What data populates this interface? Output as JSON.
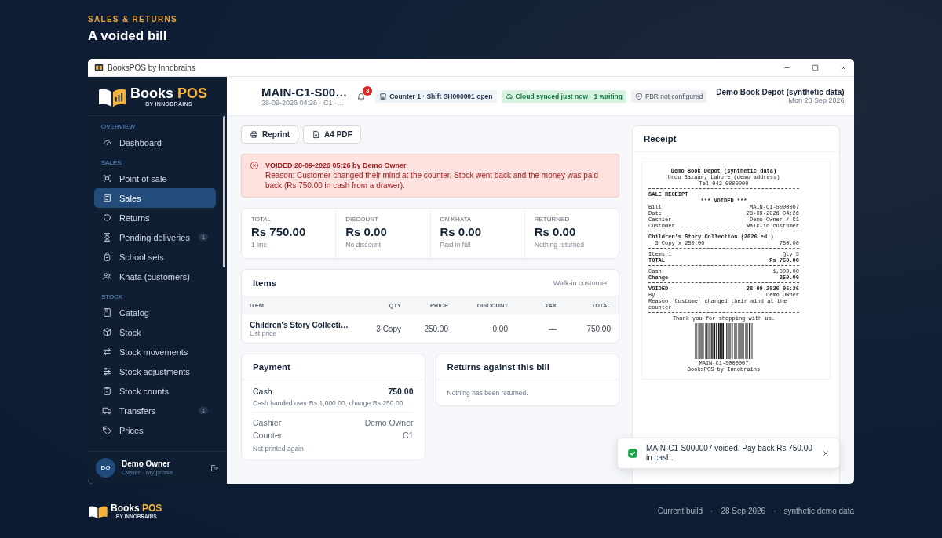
{
  "page": {
    "eyebrow": "SALES & RETURNS",
    "title": "A voided bill"
  },
  "window": {
    "title": "BooksPOS by Innobrains"
  },
  "brand": {
    "name": "Books",
    "accent": "POS",
    "tagline": "BY INNOBRAINS"
  },
  "sidebar": {
    "sections": [
      {
        "label": "OVERVIEW",
        "items": [
          {
            "label": "Dashboard",
            "selected": false
          }
        ]
      },
      {
        "label": "SALES",
        "items": [
          {
            "label": "Point of sale",
            "selected": false
          },
          {
            "label": "Sales",
            "selected": true
          },
          {
            "label": "Returns",
            "selected": false
          },
          {
            "label": "Pending deliveries",
            "selected": false,
            "badge": "1"
          },
          {
            "label": "School sets",
            "selected": false
          },
          {
            "label": "Khata (customers)",
            "selected": false
          }
        ]
      },
      {
        "label": "STOCK",
        "items": [
          {
            "label": "Catalog",
            "selected": false
          },
          {
            "label": "Stock",
            "selected": false
          },
          {
            "label": "Stock movements",
            "selected": false
          },
          {
            "label": "Stock adjustments",
            "selected": false
          },
          {
            "label": "Stock counts",
            "selected": false
          },
          {
            "label": "Transfers",
            "selected": false,
            "badge": "1"
          },
          {
            "label": "Prices",
            "selected": false
          }
        ]
      }
    ],
    "user": {
      "initials": "DO",
      "name": "Demo Owner",
      "role": "Owner · My profile"
    }
  },
  "topbar": {
    "title": "MAIN-C1-S00…",
    "subtitle": "28-09-2026 04:26 · C1 ·…",
    "notifications": "3",
    "chips": [
      {
        "kind": "info",
        "text": "Counter 1 · Shift SH000001 open"
      },
      {
        "kind": "success",
        "text": "Cloud synced just now · 1 waiting"
      },
      {
        "kind": "neutral",
        "text": "FBR not configured"
      }
    ],
    "store": "Demo Book Depot (synthetic data)",
    "date": "Mon 28 Sep 2026"
  },
  "actions": [
    {
      "kind": "print",
      "label": "Reprint"
    },
    {
      "kind": "pdf",
      "label": "A4 PDF"
    }
  ],
  "alert": {
    "title": "VOIDED 28-09-2026 05:26 by Demo Owner",
    "text": "Reason: Customer changed their mind at the counter. Stock went back and the money was paid back (Rs 750.00 in cash from a drawer)."
  },
  "stats": [
    {
      "label": "TOTAL",
      "value": "Rs 750.00",
      "note": "1 line"
    },
    {
      "label": "DISCOUNT",
      "value": "Rs 0.00",
      "note": "No discount"
    },
    {
      "label": "ON KHATA",
      "value": "Rs 0.00",
      "note": "Paid in full"
    },
    {
      "label": "RETURNED",
      "value": "Rs 0.00",
      "note": "Nothing returned"
    }
  ],
  "items": {
    "title": "Items",
    "customer": "Walk-in customer",
    "columns": [
      "ITEM",
      "QTY",
      "PRICE",
      "DISCOUNT",
      "TAX",
      "TOTAL"
    ],
    "rows": [
      {
        "note": "List price",
        "cells": [
          "Children's Story Collecti…",
          "3 Copy",
          "250.00",
          "0.00",
          "—",
          "750.00"
        ]
      }
    ]
  },
  "payment": {
    "title": "Payment",
    "method": "Cash",
    "amount": "750.00",
    "note": "Cash handed over Rs 1,000.00, change Rs 250.00",
    "details": [
      {
        "label": "Cashier",
        "value": "Demo Owner"
      },
      {
        "label": "Counter",
        "value": "C1"
      }
    ],
    "footnote": "Not printed again"
  },
  "returns": {
    "title": "Returns against this bill",
    "empty": "Nothing has been returned."
  },
  "receipt": {
    "title": "Receipt",
    "lines": [
      {
        "kind": "center",
        "bold": true,
        "text": "Demo Book Depot (synthetic data)"
      },
      {
        "kind": "center",
        "bold": false,
        "text": "Urdu Bazaar, Lahore (demo address)"
      },
      {
        "kind": "center",
        "bold": false,
        "text": "Tel 042-0000000"
      },
      {
        "kind": "rule"
      },
      {
        "kind": "text",
        "bold": true,
        "text": "SALE RECEIPT"
      },
      {
        "kind": "center",
        "bold": true,
        "text": "*** VOIDED ***"
      },
      {
        "kind": "pair",
        "bold": false,
        "text": "Bill",
        "value": "MAIN-C1-S000007"
      },
      {
        "kind": "pair",
        "bold": false,
        "text": "Date",
        "value": "28-09-2026 04:26"
      },
      {
        "kind": "pair",
        "bold": false,
        "text": "Cashier",
        "value": "Demo Owner / C1"
      },
      {
        "kind": "pair",
        "bold": false,
        "text": "Customer",
        "value": "Walk-in customer"
      },
      {
        "kind": "rule"
      },
      {
        "kind": "text",
        "bold": true,
        "text": "Children's Story Collection (2026 ed.)"
      },
      {
        "kind": "pair",
        "bold": false,
        "text": "  3 Copy x 250.00",
        "value": "750.00"
      },
      {
        "kind": "rule"
      },
      {
        "kind": "pair",
        "bold": false,
        "text": "Items 1",
        "value": "Qty 3"
      },
      {
        "kind": "pair",
        "bold": true,
        "text": "TOTAL",
        "value": "Rs 750.00"
      },
      {
        "kind": "rule"
      },
      {
        "kind": "pair",
        "bold": false,
        "text": "Cash",
        "value": "1,000.00"
      },
      {
        "kind": "pair",
        "bold": true,
        "text": "Change",
        "value": "250.00"
      },
      {
        "kind": "rule"
      },
      {
        "kind": "pair",
        "bold": true,
        "text": "VOIDED",
        "value": "28-09-2026 05:26"
      },
      {
        "kind": "pair",
        "bold": false,
        "text": "By",
        "value": "Demo Owner"
      },
      {
        "kind": "text",
        "bold": false,
        "text": "Reason: Customer changed their mind at the counter"
      },
      {
        "kind": "rule"
      },
      {
        "kind": "center",
        "bold": false,
        "text": "Thank you for shopping with us."
      },
      {
        "kind": "barcode"
      },
      {
        "kind": "center",
        "bold": false,
        "text": "MAIN-C1-S000007"
      },
      {
        "kind": "center",
        "bold": false,
        "text": "BooksPOS by Innobrains"
      }
    ]
  },
  "toast": {
    "text": "MAIN-C1-S000007 voided. Pay back Rs 750.00 in cash."
  },
  "footer": {
    "brand": {
      "name": "Books",
      "accent": "POS",
      "tagline": "BY INNOBRAINS"
    },
    "separator": "·",
    "meta": [
      "Current build",
      "28 Sep 2026",
      "synthetic demo data"
    ]
  }
}
